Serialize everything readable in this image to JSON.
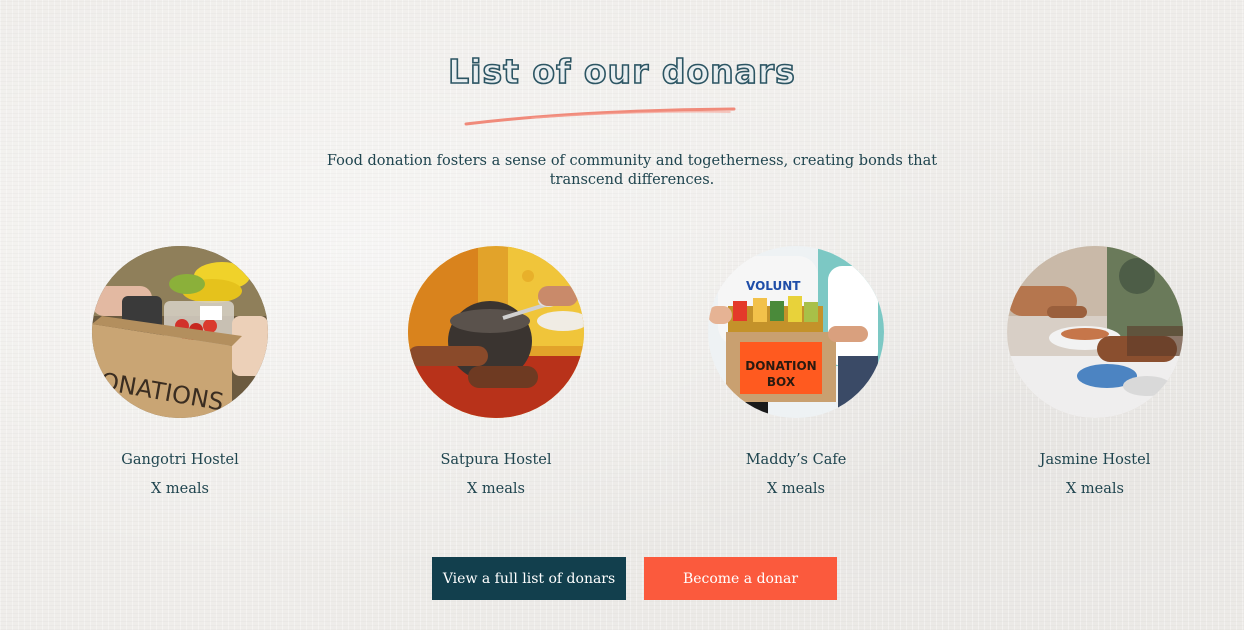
{
  "section": {
    "title": "List of our donars",
    "subtitle": "Food donation fosters a sense of community and togetherness, creating bonds that transcend differences."
  },
  "donors": [
    {
      "name": "Gangotri Hostel",
      "meals": "X meals",
      "image_text": "ONATIONS"
    },
    {
      "name": "Satpura Hostel",
      "meals": "X meals"
    },
    {
      "name": "Maddy’s Cafe",
      "meals": "X meals",
      "image_text": "DONATION BOX",
      "shirt_text": "VOLUNT"
    },
    {
      "name": "Jasmine Hostel",
      "meals": "X meals"
    }
  ],
  "buttons": {
    "view_all": "View a full list of donars",
    "become": "Become a donar"
  },
  "colors": {
    "primary_dark": "#123f4d",
    "accent": "#fb5a3d",
    "underline": "#f08a7a",
    "text": "#20454f",
    "background": "#efedea"
  }
}
